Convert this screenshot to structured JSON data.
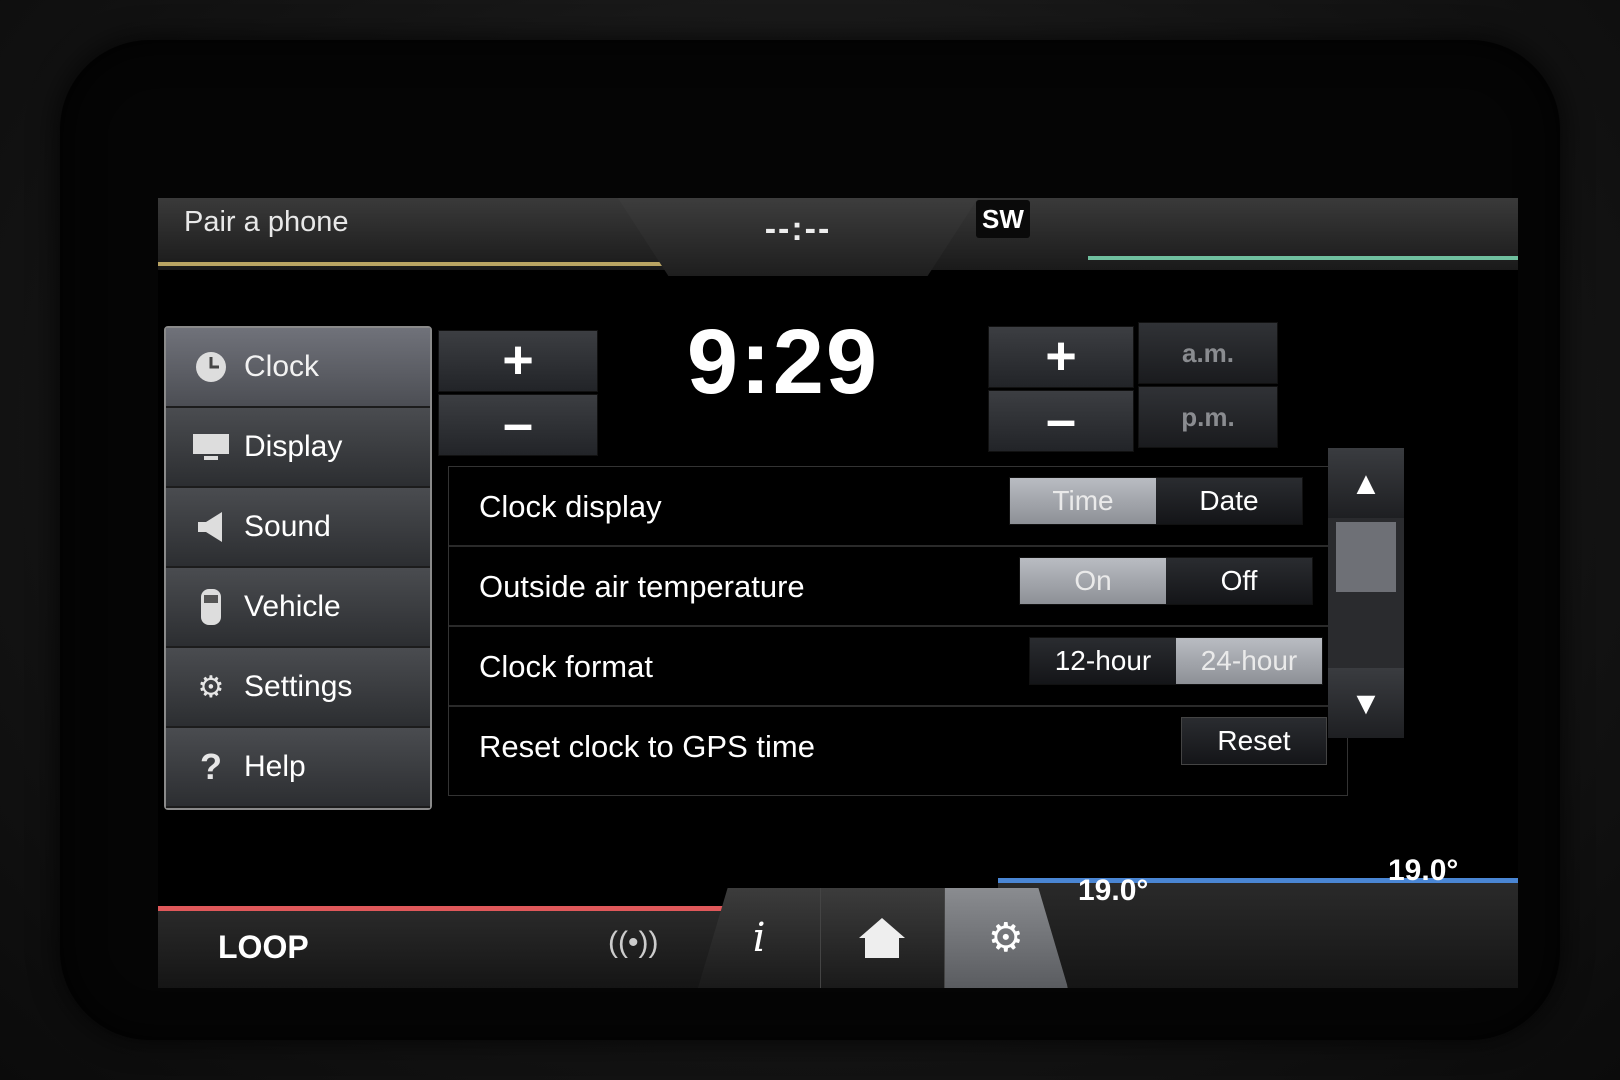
{
  "header": {
    "phone_label": "Pair a phone",
    "clock": "--:--",
    "compass": "SW"
  },
  "sidebar": {
    "items": [
      {
        "label": "Clock",
        "icon": "clock-icon",
        "active": true
      },
      {
        "label": "Display",
        "icon": "display-icon",
        "active": false
      },
      {
        "label": "Sound",
        "icon": "speaker-icon",
        "active": false
      },
      {
        "label": "Vehicle",
        "icon": "car-icon",
        "active": false
      },
      {
        "label": "Settings",
        "icon": "gear-icon",
        "active": false
      },
      {
        "label": "Help",
        "icon": "question-icon",
        "active": false
      }
    ]
  },
  "time_setter": {
    "hour_plus": "+",
    "hour_minus": "–",
    "time": "9:29",
    "minute_plus": "+",
    "minute_minus": "–",
    "am": "a.m.",
    "pm": "p.m."
  },
  "settings": {
    "clock_display": {
      "label": "Clock display",
      "options": [
        "Time",
        "Date"
      ],
      "selected": "Time"
    },
    "outside_air_temp": {
      "label": "Outside air temperature",
      "options": [
        "On",
        "Off"
      ],
      "selected": "On"
    },
    "clock_format": {
      "label": "Clock format",
      "options": [
        "12-hour",
        "24-hour"
      ],
      "selected": "24-hour"
    },
    "reset_clock": {
      "label": "Reset clock to GPS time",
      "button": "Reset"
    }
  },
  "bottom": {
    "source": "LOOP",
    "temp_left": "19.0°",
    "temp_right": "19.0°",
    "tabs": [
      "info-icon",
      "home-icon",
      "settings-gears-icon"
    ],
    "active_tab": "settings-gears-icon"
  },
  "colors": {
    "phone_accent": "#b9a463",
    "nav_accent": "#6fbf9e",
    "entertainment_accent": "#e0585a",
    "climate_accent": "#4a86d4"
  }
}
